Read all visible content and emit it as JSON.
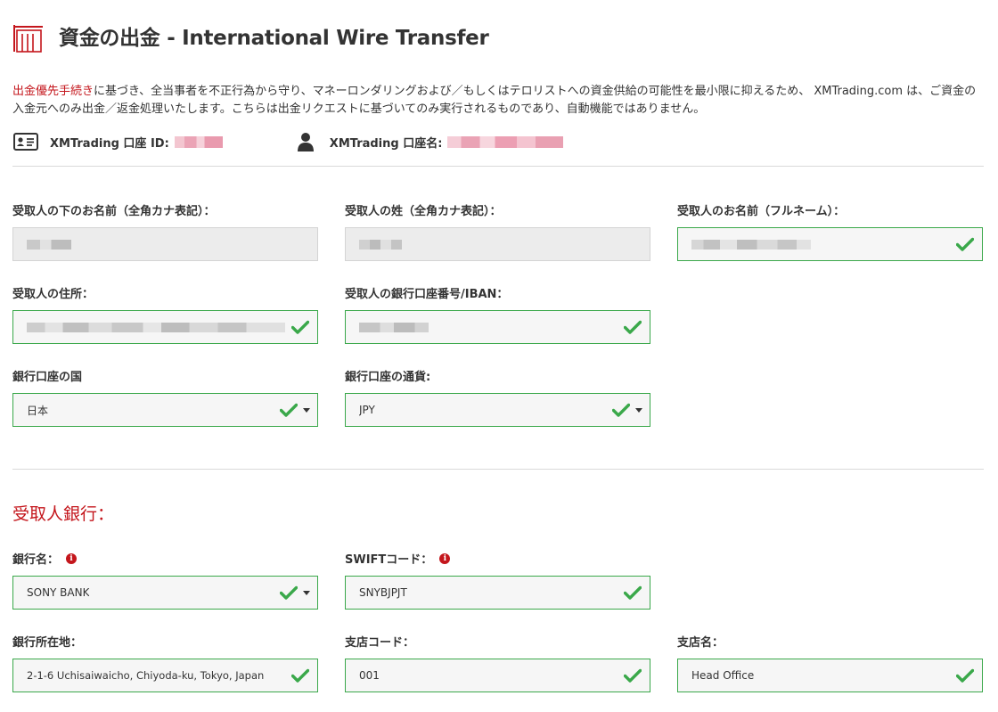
{
  "header": {
    "title": "資金の出金 - International Wire Transfer"
  },
  "notice": {
    "link_text": "出金優先手続き",
    "body_text": "に基づき、全当事者を不正行為から守り、マネーロンダリングおよび／もしくはテロリストへの資金供給の可能性を最小限に抑えるため、 XMTrading.com は、ご資金の入金元へのみ出金／返金処理いたします。こちらは出金リクエストに基づいてのみ実行されるものであり、自動機能ではありません。"
  },
  "account": {
    "id_label": "XMTrading 口座 ID:",
    "name_label": "XMTrading 口座名:"
  },
  "beneficiary": {
    "first_name_label": "受取人の下のお名前（全角カナ表記）：",
    "last_name_label": "受取人の姓（全角カナ表記）：",
    "full_name_label": "受取人のお名前（フルネーム）：",
    "address_label": "受取人の住所：",
    "account_label": "受取人の銀行口座番号/IBAN：",
    "country_label": "銀行口座の国",
    "country_value": "日本",
    "currency_label": "銀行口座の通貨:",
    "currency_value": "JPY"
  },
  "bank": {
    "section_title": "受取人銀行：",
    "name_label": "銀行名：",
    "name_value": "SONY BANK",
    "swift_label": "SWIFTコード：",
    "swift_value": "SNYBJPJT",
    "address_label": "銀行所在地：",
    "address_value": "2-1-6 Uchisaiwaicho, Chiyoda-ku, Tokyo, Japan",
    "branch_code_label": "支店コード：",
    "branch_code_value": "001",
    "branch_name_label": "支店名：",
    "branch_name_value": "Head Office"
  },
  "icons": {
    "header": "withdrawal-icon",
    "account_id": "id-card-icon",
    "account_name": "user-icon",
    "valid": "checkmark-icon",
    "info": "info-icon",
    "dropdown": "caret-down-icon"
  },
  "colors": {
    "accent_red": "#c4161c",
    "valid_green": "#3aa84a"
  }
}
